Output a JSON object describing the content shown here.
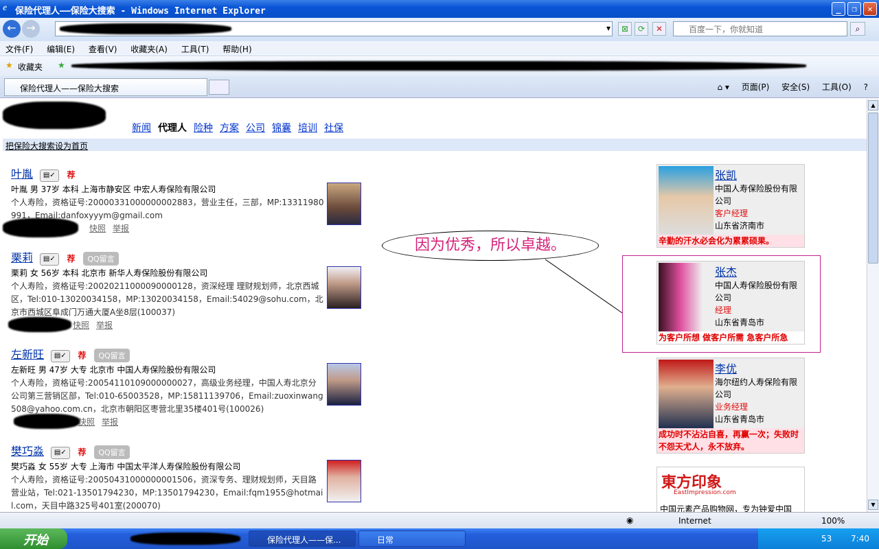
{
  "window": {
    "title": "保险代理人——保险大搜索 - Windows Internet Explorer"
  },
  "search": {
    "placeholder": "百度一下，你就知道"
  },
  "menu": [
    "文件(F)",
    "编辑(E)",
    "查看(V)",
    "收藏夹(A)",
    "工具(T)",
    "帮助(H)"
  ],
  "favorites": {
    "label": "收藏夹"
  },
  "tab": {
    "title": "保险代理人——保险大搜索"
  },
  "commands": [
    "页面(P)",
    "安全(S)",
    "工具(O)"
  ],
  "site_nav": [
    "新闻",
    "代理人",
    "险种",
    "方案",
    "公司",
    "锦囊",
    "培训",
    "社保"
  ],
  "set_home": "把保险大搜索设为首页",
  "callout": "因为优秀，所以卓越。",
  "agents": [
    {
      "name": "叶胤",
      "line1": "叶胤  男  37岁  本科  上海市静安区  中宏人寿保险有限公司",
      "detail": "个人寿险，资格证号:20000331000000002883，营业主任，三部，MP:13311980991，Email:danfoxyyym@gmail.com",
      "links": [
        "快照",
        "举报"
      ],
      "qq": ""
    },
    {
      "name": "栗莉",
      "line1": "栗莉  女  56岁  本科  北京市  新华人寿保险股份有限公司",
      "detail": "个人寿险，资格证号:20020211000090000128，资深经理 理财规划师，北京西城区，Tel:010-13020034158，MP:13020034158，Email:54029@sohu.com，北京市西城区阜成门万通大厦A坐8层(100037)",
      "links": [
        "快照",
        "举报"
      ],
      "qq": "QQ留言"
    },
    {
      "name": "左新旺",
      "line1": "左新旺  男  47岁  大专  北京市  中国人寿保险股份有限公司",
      "detail": "个人寿险，资格证号:20054110109000000027，高级业务经理，中国人寿北京分公司第三营销区部，Tel:010-65003528，MP:15811139706，Email:zuoxinwang508@yahoo.com.cn，北京市朝阳区枣营北里35楼401号(100026)",
      "links": [
        "快照",
        "举报"
      ],
      "qq": "QQ留言"
    },
    {
      "name": "樊巧淼",
      "line1": "樊巧淼  女  55岁  大专  上海市  中国太平洋人寿保险股份有限公司",
      "detail": "个人寿险，资格证号:20050431000000001506，资深专务、理财规划师，天目路营业站，Tel:021-13501794230，MP:13501794230，Email:fqm1955@hotmail.com，天目中路325号401室(200070)",
      "links": [],
      "qq": "QQ留言"
    }
  ],
  "rec_label": "荐",
  "cards": [
    {
      "name": "张凯",
      "company": "中国人寿保险股份有限公司",
      "role": "客户经理",
      "city": "山东省济南市",
      "slogan": "辛勤的汗水必会化为累累硕果。"
    },
    {
      "name": "张杰",
      "company": "中国人寿保险股份有限公司",
      "role": "经理",
      "city": "山东省青岛市",
      "slogan": "为客户所想  做客户所需  急客户所急"
    },
    {
      "name": "李优",
      "company": "海尔纽约人寿保险有限公司",
      "role": "业务经理",
      "city": "山东省青岛市",
      "slogan": "成功时不沾沾自喜，再赢一次；失败时不怨天尤人，永不放弃。"
    }
  ],
  "ad": {
    "logo": "東方印象",
    "sub": "EastImpression.com",
    "text": "中国元素产品购物网，专为钟爱中国"
  },
  "status": {
    "zone": "Internet",
    "zoom": "100%"
  },
  "taskbar": {
    "start": "开始",
    "tasks": [
      "保险代理人——保...",
      "日常"
    ],
    "num": "53",
    "clock": "7:40"
  },
  "colors": {
    "title_blue": "#0a55d6",
    "link": "#0033aa",
    "accent_pink": "#d4237a",
    "rec_red": "#e01010"
  }
}
